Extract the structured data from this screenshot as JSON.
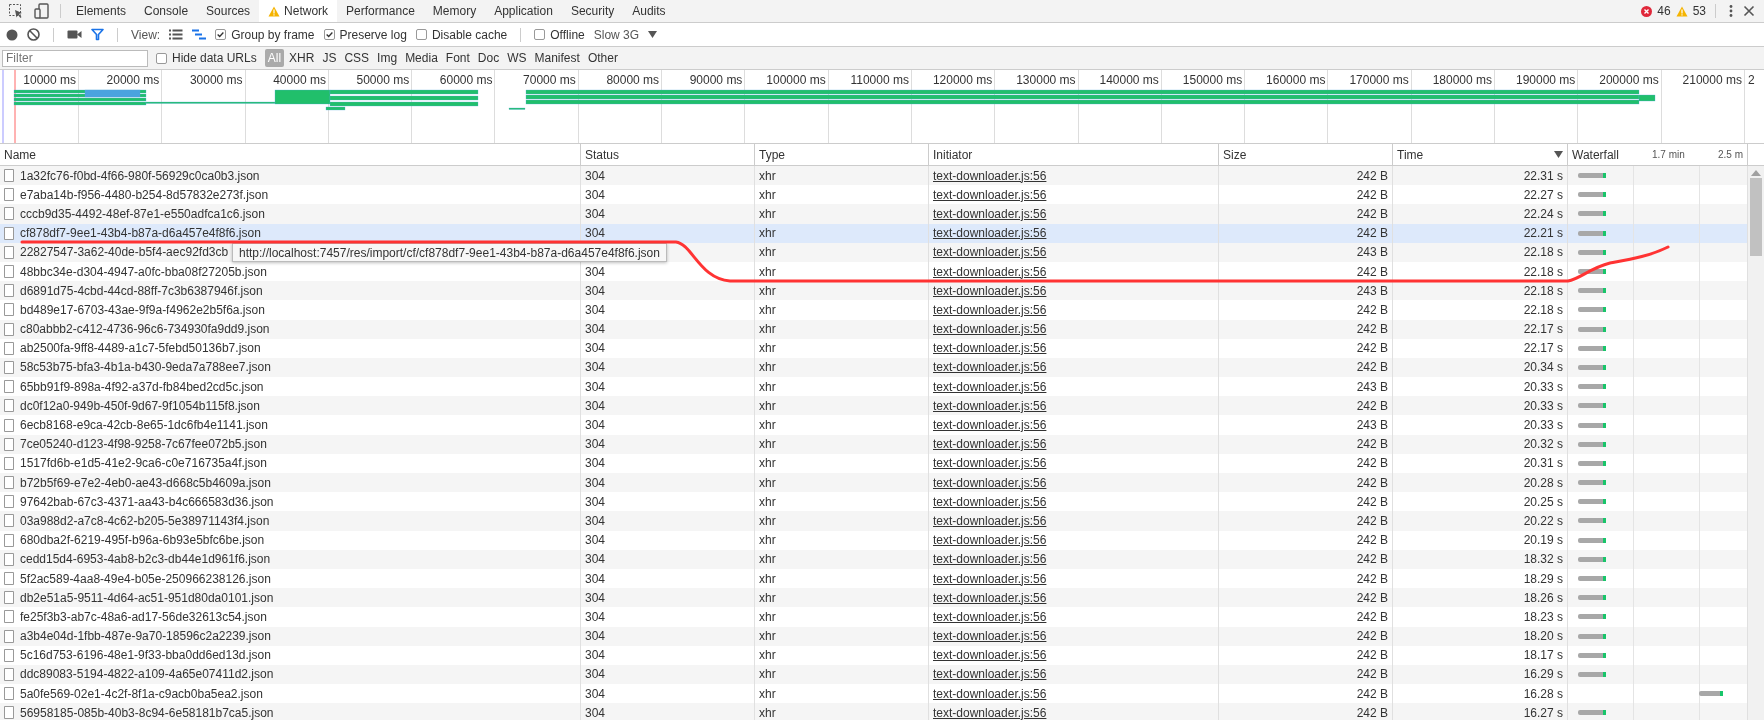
{
  "devtools_tabs": [
    {
      "label": "Elements",
      "selected": false,
      "warning": false
    },
    {
      "label": "Console",
      "selected": false,
      "warning": false
    },
    {
      "label": "Sources",
      "selected": false,
      "warning": false
    },
    {
      "label": "Network",
      "selected": true,
      "warning": true
    },
    {
      "label": "Performance",
      "selected": false,
      "warning": false
    },
    {
      "label": "Memory",
      "selected": false,
      "warning": false
    },
    {
      "label": "Application",
      "selected": false,
      "warning": false
    },
    {
      "label": "Security",
      "selected": false,
      "warning": false
    },
    {
      "label": "Audits",
      "selected": false,
      "warning": false
    }
  ],
  "console_counts": {
    "errors": "46",
    "warnings": "53"
  },
  "toolbar": {
    "recording": true,
    "filter_active": true,
    "view_label": "View:",
    "waterfall_view": true,
    "options": [
      {
        "label": "Group by frame",
        "checked": true
      },
      {
        "label": "Preserve log",
        "checked": true
      },
      {
        "label": "Disable cache",
        "checked": false
      }
    ],
    "offline": {
      "label": "Offline",
      "checked": false
    },
    "throttling": "Slow 3G"
  },
  "filter_bar": {
    "placeholder": "Filter",
    "hide_data_urls": {
      "label": "Hide data URLs",
      "checked": false
    },
    "types": [
      {
        "label": "All",
        "selected": true
      },
      {
        "label": "XHR",
        "selected": false
      },
      {
        "label": "JS",
        "selected": false
      },
      {
        "label": "CSS",
        "selected": false
      },
      {
        "label": "Img",
        "selected": false
      },
      {
        "label": "Media",
        "selected": false
      },
      {
        "label": "Font",
        "selected": false
      },
      {
        "label": "Doc",
        "selected": false
      },
      {
        "label": "WS",
        "selected": false
      },
      {
        "label": "Manifest",
        "selected": false
      },
      {
        "label": "Other",
        "selected": false
      }
    ]
  },
  "overview": {
    "tick_labels": [
      "10000 ms",
      "20000 ms",
      "30000 ms",
      "40000 ms",
      "50000 ms",
      "60000 ms",
      "70000 ms",
      "80000 ms",
      "90000 ms",
      "100000 ms",
      "110000 ms",
      "120000 ms",
      "130000 ms",
      "140000 ms",
      "150000 ms",
      "160000 ms",
      "170000 ms",
      "180000 ms",
      "190000 ms",
      "200000 ms",
      "210000 ms",
      "2"
    ]
  },
  "table": {
    "columns": [
      {
        "label": "Name",
        "sorted": false
      },
      {
        "label": "Status",
        "sorted": false
      },
      {
        "label": "Type",
        "sorted": false
      },
      {
        "label": "Initiator",
        "sorted": false
      },
      {
        "label": "Size",
        "sorted": false
      },
      {
        "label": "Time",
        "sorted": true
      },
      {
        "label": "Waterfall",
        "sorted": false
      }
    ],
    "waterfall_ticks": [
      "1.7 min",
      "2.5 m"
    ],
    "rows": [
      {
        "name": "1a32fc76-f0bd-4f66-980f-56929c0ca0b3.json",
        "status": "304",
        "type": "xhr",
        "initiator": "text-downloader.js:56",
        "size": "242 B",
        "time": "22.31 s",
        "hovered": false,
        "kind": "early"
      },
      {
        "name": "e7aba14b-f956-4480-b254-8d57832e273f.json",
        "status": "304",
        "type": "xhr",
        "initiator": "text-downloader.js:56",
        "size": "242 B",
        "time": "22.27 s",
        "hovered": false,
        "kind": "early"
      },
      {
        "name": "cccb9d35-4492-48ef-87e1-e550adfca1c6.json",
        "status": "304",
        "type": "xhr",
        "initiator": "text-downloader.js:56",
        "size": "242 B",
        "time": "22.24 s",
        "hovered": false,
        "kind": "early"
      },
      {
        "name": "cf878df7-9ee1-43b4-b87a-d6a457e4f8f6.json",
        "status": "304",
        "type": "xhr",
        "initiator": "text-downloader.js:56",
        "size": "242 B",
        "time": "22.21 s",
        "hovered": true,
        "kind": "early"
      },
      {
        "name": "22827547-3a62-40de-b5f4-aec92fd3cb",
        "type": "xhr",
        "initiator": "text-downloader.js:56",
        "size": "243 B",
        "time": "22.18 s",
        "hovered": false,
        "kind": "early"
      },
      {
        "name": "48bbc34e-d304-4947-a0fc-bba08f27205b.json",
        "status": "304",
        "type": "xhr",
        "initiator": "text-downloader.js:56",
        "size": "242 B",
        "time": "22.18 s",
        "hovered": false,
        "kind": "early"
      },
      {
        "name": "d6891d75-4cbd-44cd-88ff-7c3b6387946f.json",
        "status": "304",
        "type": "xhr",
        "initiator": "text-downloader.js:56",
        "size": "243 B",
        "time": "22.18 s",
        "hovered": false,
        "kind": "early"
      },
      {
        "name": "bd489e17-6703-43ae-9f9a-f4962e2b5f6a.json",
        "status": "304",
        "type": "xhr",
        "initiator": "text-downloader.js:56",
        "size": "242 B",
        "time": "22.18 s",
        "hovered": false,
        "kind": "early"
      },
      {
        "name": "c80abbb2-c412-4736-96c6-734930fa9dd9.json",
        "status": "304",
        "type": "xhr",
        "initiator": "text-downloader.js:56",
        "size": "242 B",
        "time": "22.17 s",
        "hovered": false,
        "kind": "early"
      },
      {
        "name": "ab2500fa-9ff8-4489-a1c7-5febd50136b7.json",
        "status": "304",
        "type": "xhr",
        "initiator": "text-downloader.js:56",
        "size": "242 B",
        "time": "22.17 s",
        "hovered": false,
        "kind": "early"
      },
      {
        "name": "58c53b75-bfa3-4b1a-b430-9eda7a788ee7.json",
        "status": "304",
        "type": "xhr",
        "initiator": "text-downloader.js:56",
        "size": "242 B",
        "time": "20.34 s",
        "hovered": false,
        "kind": "early"
      },
      {
        "name": "65bb91f9-898a-4f92-a37d-fb84bed2cd5c.json",
        "status": "304",
        "type": "xhr",
        "initiator": "text-downloader.js:56",
        "size": "243 B",
        "time": "20.33 s",
        "hovered": false,
        "kind": "early"
      },
      {
        "name": "dc0f12a0-949b-450f-9d67-9f1054b115f8.json",
        "status": "304",
        "type": "xhr",
        "initiator": "text-downloader.js:56",
        "size": "242 B",
        "time": "20.33 s",
        "hovered": false,
        "kind": "early"
      },
      {
        "name": "6ecb8168-e9ca-42cb-8e65-1dc6fb4e1141.json",
        "status": "304",
        "type": "xhr",
        "initiator": "text-downloader.js:56",
        "size": "243 B",
        "time": "20.33 s",
        "hovered": false,
        "kind": "early"
      },
      {
        "name": "7ce05240-d123-4f98-9258-7c67fee072b5.json",
        "status": "304",
        "type": "xhr",
        "initiator": "text-downloader.js:56",
        "size": "242 B",
        "time": "20.32 s",
        "hovered": false,
        "kind": "early"
      },
      {
        "name": "1517fd6b-e1d5-41e2-9ca6-c0e716735a4f.json",
        "status": "304",
        "type": "xhr",
        "initiator": "text-downloader.js:56",
        "size": "242 B",
        "time": "20.31 s",
        "hovered": false,
        "kind": "early"
      },
      {
        "name": "b72b5f69-e7e2-4eb0-ae43-d668c5b4609a.json",
        "status": "304",
        "type": "xhr",
        "initiator": "text-downloader.js:56",
        "size": "242 B",
        "time": "20.28 s",
        "hovered": false,
        "kind": "early"
      },
      {
        "name": "97642bab-67c3-4371-aa43-b4c666583d36.json",
        "status": "304",
        "type": "xhr",
        "initiator": "text-downloader.js:56",
        "size": "242 B",
        "time": "20.25 s",
        "hovered": false,
        "kind": "early"
      },
      {
        "name": "03a988d2-a7c8-4c62-b205-5e38971143f4.json",
        "status": "304",
        "type": "xhr",
        "initiator": "text-downloader.js:56",
        "size": "242 B",
        "time": "20.22 s",
        "hovered": false,
        "kind": "early"
      },
      {
        "name": "680dba2f-6219-495f-b96a-6b93e5bfc6be.json",
        "status": "304",
        "type": "xhr",
        "initiator": "text-downloader.js:56",
        "size": "242 B",
        "time": "20.19 s",
        "hovered": false,
        "kind": "early"
      },
      {
        "name": "cedd15d4-6953-4ab8-b2c3-db44e1d961f6.json",
        "status": "304",
        "type": "xhr",
        "initiator": "text-downloader.js:56",
        "size": "242 B",
        "time": "18.32 s",
        "hovered": false,
        "kind": "early"
      },
      {
        "name": "5f2ac589-4aa8-49e4-b05e-250966238126.json",
        "status": "304",
        "type": "xhr",
        "initiator": "text-downloader.js:56",
        "size": "242 B",
        "time": "18.29 s",
        "hovered": false,
        "kind": "early"
      },
      {
        "name": "db2e51a5-9511-4d64-ac51-951d80da0101.json",
        "status": "304",
        "type": "xhr",
        "initiator": "text-downloader.js:56",
        "size": "242 B",
        "time": "18.26 s",
        "hovered": false,
        "kind": "early"
      },
      {
        "name": "fe25f3b3-ab7c-48a6-ad17-56de32613c54.json",
        "status": "304",
        "type": "xhr",
        "initiator": "text-downloader.js:56",
        "size": "242 B",
        "time": "18.23 s",
        "hovered": false,
        "kind": "early"
      },
      {
        "name": "a3b4e04d-1fbb-487e-9a70-18596c2a2239.json",
        "status": "304",
        "type": "xhr",
        "initiator": "text-downloader.js:56",
        "size": "242 B",
        "time": "18.20 s",
        "hovered": false,
        "kind": "early"
      },
      {
        "name": "5c16d753-6196-48e1-9f33-bba0dd6ed13d.json",
        "status": "304",
        "type": "xhr",
        "initiator": "text-downloader.js:56",
        "size": "242 B",
        "time": "18.17 s",
        "hovered": false,
        "kind": "early"
      },
      {
        "name": "ddc89083-5194-4822-a109-4a65e07411d2.json",
        "status": "304",
        "type": "xhr",
        "initiator": "text-downloader.js:56",
        "size": "242 B",
        "time": "16.29 s",
        "hovered": false,
        "kind": "early"
      },
      {
        "name": "5a0fe569-02e1-4c2f-8f1a-c9acb0ba5ea2.json",
        "status": "304",
        "type": "xhr",
        "initiator": "text-downloader.js:56",
        "size": "242 B",
        "time": "16.28 s",
        "hovered": false,
        "kind": "late"
      },
      {
        "name": "56958185-085b-40b3-8c94-6e58181b7ca5.json",
        "status": "304",
        "type": "xhr",
        "initiator": "text-downloader.js:56",
        "size": "242 B",
        "time": "16.27 s",
        "hovered": false,
        "kind": "early"
      }
    ],
    "tooltip": "http://localhost:7457/res/import/cf/cf878df7-9ee1-43b4-b87a-d6a457e4f8f6.json"
  }
}
